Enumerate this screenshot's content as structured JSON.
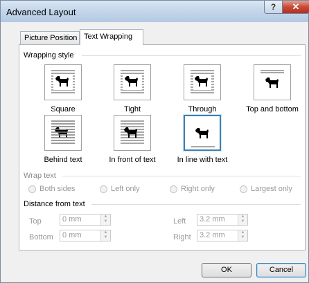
{
  "window": {
    "title": "Advanced Layout",
    "help": "?",
    "close": "✕"
  },
  "tabs": [
    {
      "label": "Picture Position"
    },
    {
      "label": "Text Wrapping"
    }
  ],
  "wrapping_style": {
    "heading": "Wrapping style",
    "options": [
      {
        "label": "Square",
        "selected": false
      },
      {
        "label": "Tight",
        "selected": false
      },
      {
        "label": "Through",
        "selected": false
      },
      {
        "label": "Top and bottom",
        "selected": false
      },
      {
        "label": "Behind text",
        "selected": false
      },
      {
        "label": "In front of text",
        "selected": false
      },
      {
        "label": "In line with text",
        "selected": true
      }
    ]
  },
  "wrap_text": {
    "heading": "Wrap text",
    "options": [
      {
        "label": "Both sides"
      },
      {
        "label": "Left only"
      },
      {
        "label": "Right only"
      },
      {
        "label": "Largest only"
      }
    ]
  },
  "distance": {
    "heading": "Distance from text",
    "top_label": "Top",
    "top_value": "0 mm",
    "bottom_label": "Bottom",
    "bottom_value": "0 mm",
    "left_label": "Left",
    "left_value": "3.2 mm",
    "right_label": "Right",
    "right_value": "3.2 mm"
  },
  "buttons": {
    "ok": "OK",
    "cancel": "Cancel"
  }
}
